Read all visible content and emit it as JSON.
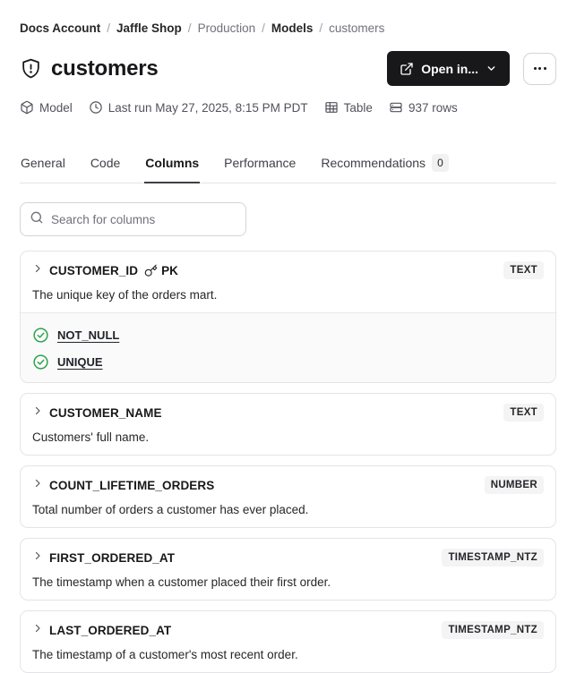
{
  "breadcrumb": {
    "separator": "/",
    "items": [
      {
        "label": "Docs Account",
        "emphasis": true
      },
      {
        "label": "Jaffle Shop",
        "emphasis": true
      },
      {
        "label": "Production",
        "emphasis": false
      },
      {
        "label": "Models",
        "emphasis": true
      },
      {
        "label": "customers",
        "emphasis": false
      }
    ]
  },
  "header": {
    "title": "customers",
    "open_in_label": "Open in...",
    "meta": [
      {
        "icon": "cube-icon",
        "label": "Model"
      },
      {
        "icon": "clock-icon",
        "label": "Last run May 27, 2025, 8:15 PM PDT"
      },
      {
        "icon": "table-icon",
        "label": "Table"
      },
      {
        "icon": "rows-icon",
        "label": "937 rows"
      }
    ]
  },
  "tabs": [
    {
      "label": "General",
      "active": false,
      "badge": null
    },
    {
      "label": "Code",
      "active": false,
      "badge": null
    },
    {
      "label": "Columns",
      "active": true,
      "badge": null
    },
    {
      "label": "Performance",
      "active": false,
      "badge": null
    },
    {
      "label": "Recommendations",
      "active": false,
      "badge": "0"
    }
  ],
  "search": {
    "placeholder": "Search for columns"
  },
  "columns": [
    {
      "name": "CUSTOMER_ID",
      "pk": "PK",
      "type": "TEXT",
      "description": "The unique key of the orders mart.",
      "tests": [
        "NOT_NULL",
        "UNIQUE"
      ]
    },
    {
      "name": "CUSTOMER_NAME",
      "pk": null,
      "type": "TEXT",
      "description": "Customers' full name.",
      "tests": []
    },
    {
      "name": "COUNT_LIFETIME_ORDERS",
      "pk": null,
      "type": "NUMBER",
      "description": "Total number of orders a customer has ever placed.",
      "tests": []
    },
    {
      "name": "FIRST_ORDERED_AT",
      "pk": null,
      "type": "TIMESTAMP_NTZ",
      "description": "The timestamp when a customer placed their first order.",
      "tests": []
    },
    {
      "name": "LAST_ORDERED_AT",
      "pk": null,
      "type": "TIMESTAMP_NTZ",
      "description": "The timestamp of a customer's most recent order.",
      "tests": []
    }
  ],
  "colors": {
    "primary_button_bg": "#18181b",
    "test_pass_green": "#2da44e",
    "badge_bg": "#f4f4f5",
    "card_border": "#e4e4e7",
    "muted_text": "#71717a"
  }
}
